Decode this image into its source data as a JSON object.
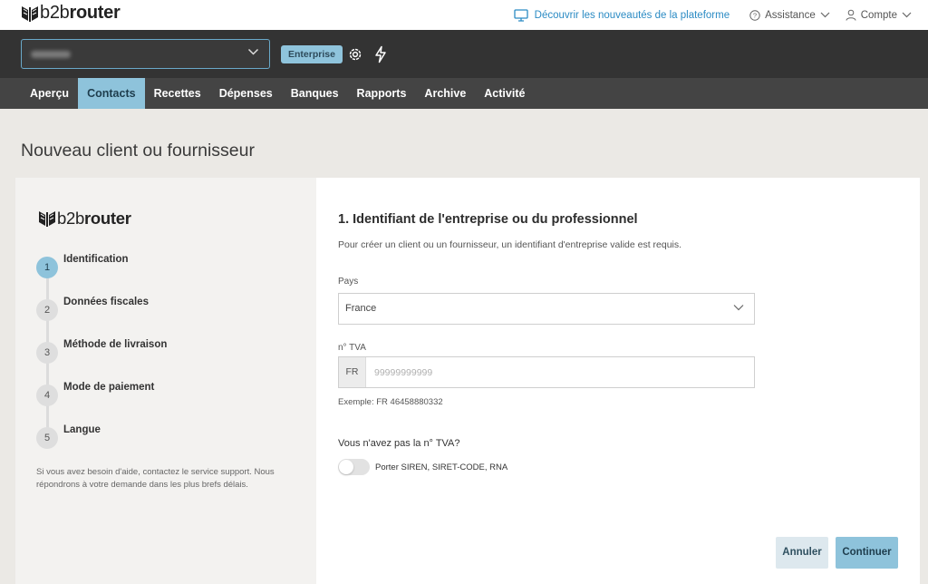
{
  "header": {
    "logo_text_light": "b2b",
    "logo_text_bold": "router",
    "discover_link": "Découvrir les nouveautés de la plateforme",
    "assistance": "Assistance",
    "account": "Compte"
  },
  "company_bar": {
    "selected_company": "",
    "plan_badge": "Enterprise"
  },
  "nav": {
    "items": [
      "Aperçu",
      "Contacts",
      "Recettes",
      "Dépenses",
      "Banques",
      "Rapports",
      "Archive",
      "Activité"
    ],
    "active": "Contacts"
  },
  "page": {
    "title": "Nouveau client ou fournisseur"
  },
  "sidebar": {
    "steps": [
      {
        "num": "1",
        "label": "Identification"
      },
      {
        "num": "2",
        "label": "Données fiscales"
      },
      {
        "num": "3",
        "label": "Méthode de livraison"
      },
      {
        "num": "4",
        "label": "Mode de paiement"
      },
      {
        "num": "5",
        "label": "Langue"
      }
    ],
    "active_step": "1",
    "help_text": "Si vous avez besoin d'aide, contactez le service support. Nous répondrons à votre demande dans les plus brefs délais."
  },
  "form": {
    "heading": "1. Identifiant de l'entreprise ou du professionnel",
    "subtitle": "Pour créer un client ou un fournisseur, un identifiant d'entreprise valide est requis.",
    "country_label": "Pays",
    "country_value": "France",
    "vat_label": "n° TVA",
    "vat_prefix": "FR",
    "vat_placeholder": "99999999999",
    "vat_value": "",
    "example": "Exemple: FR 46458880332",
    "no_vat_question": "Vous n'avez pas la n° TVA?",
    "toggle_label": "Porter SIREN, SIRET-CODE, RNA",
    "toggle_on": false
  },
  "actions": {
    "cancel": "Annuler",
    "continue": "Continuer"
  },
  "colors": {
    "accent": "#8ec3db",
    "link": "#2b8bc4",
    "dark_bar": "#333333",
    "nav_bar": "#444444"
  }
}
